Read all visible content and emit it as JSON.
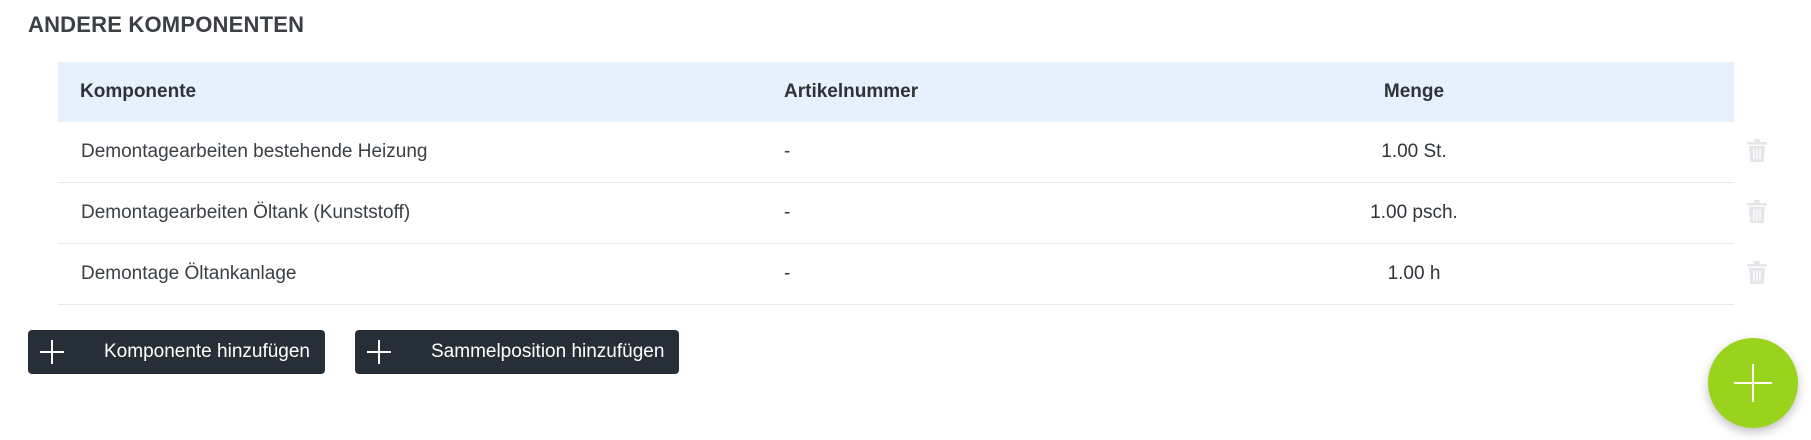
{
  "section": {
    "title": "ANDERE KOMPONENTEN"
  },
  "table": {
    "headers": {
      "name": "Komponente",
      "article": "Artikelnummer",
      "quantity": "Menge"
    },
    "rows": [
      {
        "name": "Demontagearbeiten bestehende Heizung",
        "article": "-",
        "quantity": "1.00 St."
      },
      {
        "name": "Demontagearbeiten Öltank (Kunststoff)",
        "article": "-",
        "quantity": "1.00 psch."
      },
      {
        "name": "Demontage Öltankanlage",
        "article": "-",
        "quantity": "1.00 h"
      }
    ]
  },
  "buttons": {
    "add_component": "Komponente hinzufügen",
    "add_collective": "Sammelposition hinzufügen"
  },
  "icons": {
    "row_action": "trash-icon",
    "button_icon": "plus-icon",
    "fab_icon": "plus-icon"
  },
  "colors": {
    "header_bg": "#e6f1fd",
    "button_bg": "#262f37",
    "fab_bg": "#9ad31c"
  }
}
